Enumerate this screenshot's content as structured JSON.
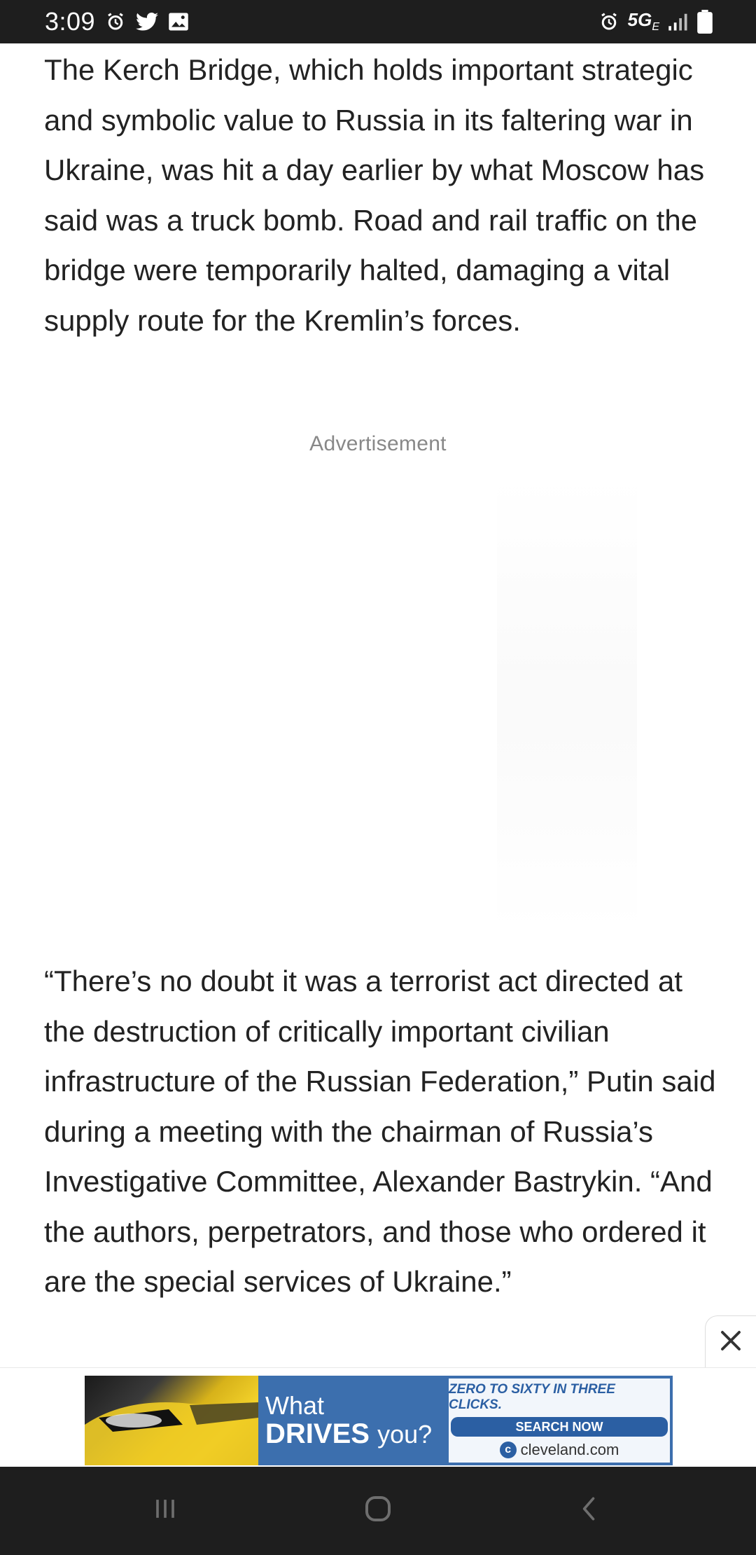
{
  "status_bar": {
    "time": "3:09",
    "left_icons": [
      "alarm-icon",
      "twitter-icon",
      "gallery-icon"
    ],
    "network_label": "5G",
    "network_sub": "E",
    "right_icons": [
      "alarm-icon",
      "signal-icon",
      "battery-icon"
    ]
  },
  "article": {
    "paragraph_1": "The Kerch Bridge, which holds important strategic and symbolic value to Russia in its faltering war in Ukraine, was hit a day earlier by what Moscow has said was a truck bomb. Road and rail traffic on the bridge were temporarily halted, damaging a vital supply route for the Kremlin’s forces.",
    "ad_label": "Advertisement",
    "paragraph_2": "“There’s no doubt it was a terrorist act directed at the destruction of critically important civilian infrastructure of the Russian Federation,” Putin said during a meeting with the chairman of Russia’s Investigative Committee, Alexander Bastrykin. “And the authors, perpetrators, and those who ordered it are the special services of Ukraine.”"
  },
  "banner_ad": {
    "what": "What",
    "drives": "DRIVES",
    "you": "you?",
    "tagline": "ZERO TO SIXTY IN THREE CLICKS.",
    "cta": "SEARCH NOW",
    "brand": "cleveland.com",
    "brand_mark": "c"
  },
  "nav_bar": {
    "buttons": [
      "recent-apps",
      "home",
      "back"
    ]
  },
  "colors": {
    "status_bg": "#1e1e1e",
    "text": "#222222",
    "ad_label": "#888888",
    "banner_blue": "#3c6fae"
  }
}
